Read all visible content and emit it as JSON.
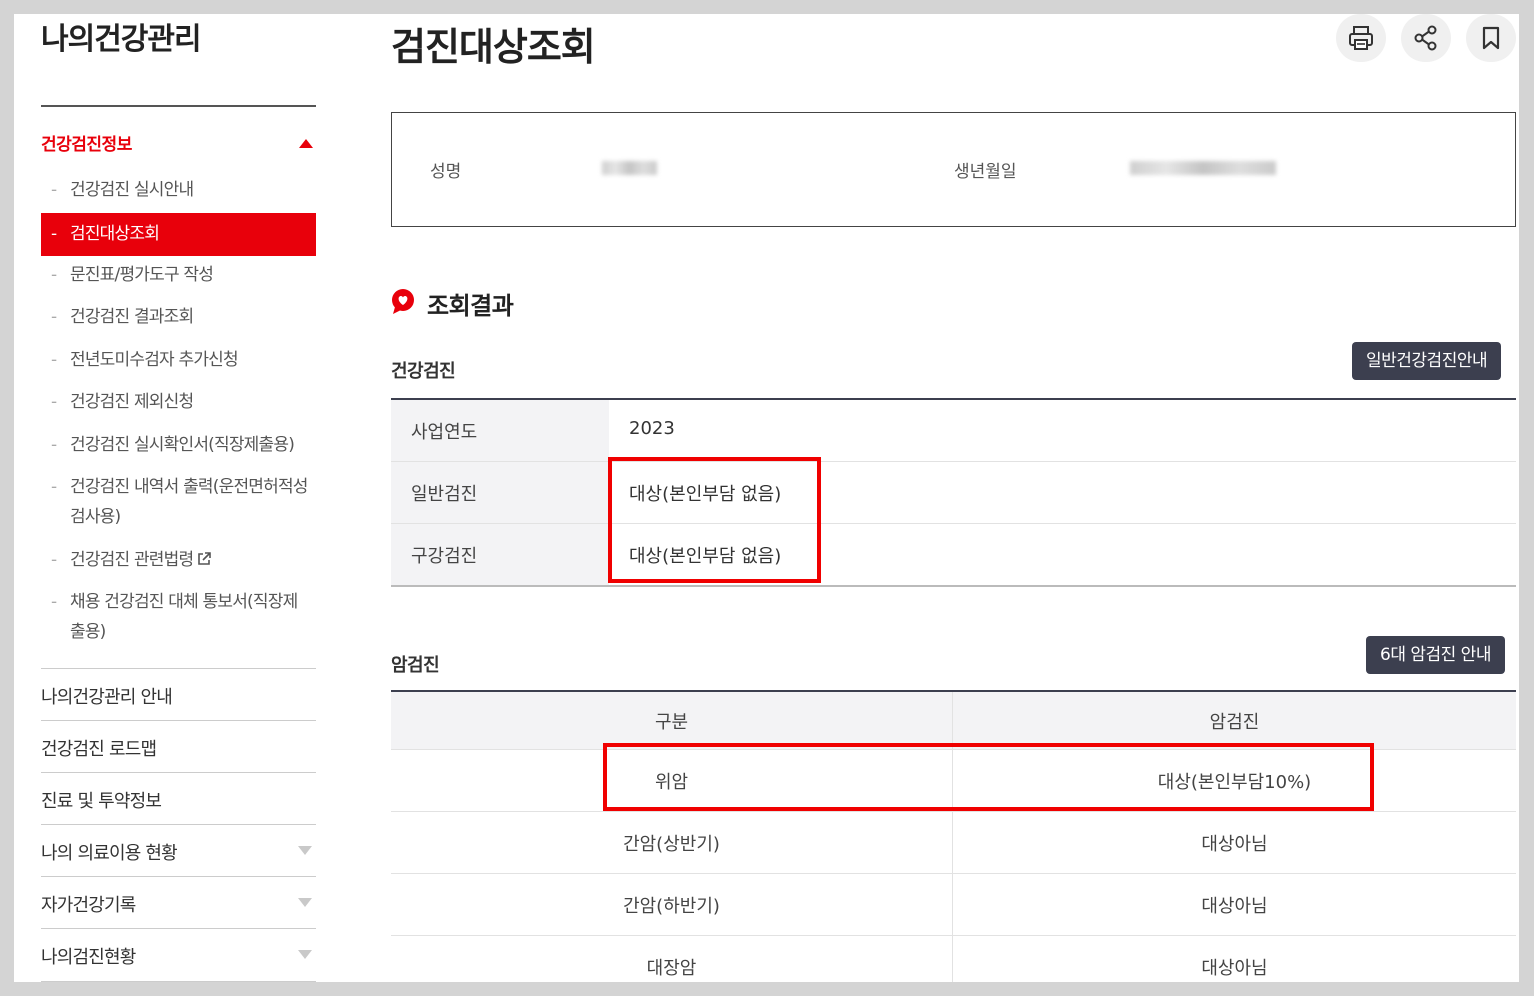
{
  "sidebar": {
    "title": "나의건강관리",
    "section": "건강검진정보",
    "sub_items": [
      {
        "label": "건강검진 실시안내"
      },
      {
        "label": "검진대상조회"
      },
      {
        "label": "문진표/평가도구 작성"
      },
      {
        "label": "건강검진 결과조회"
      },
      {
        "label": "전년도미수검자 추가신청"
      },
      {
        "label": "건강검진 제외신청"
      },
      {
        "label": "건강검진 실시확인서(직장제출용)"
      },
      {
        "label": "건강검진 내역서 출력(운전면허적성검사용)"
      },
      {
        "label": "건강검진 관련법령"
      },
      {
        "label": "채용 건강검진 대체 통보서(직장제출용)"
      }
    ],
    "menus": [
      {
        "label": "나의건강관리 안내"
      },
      {
        "label": "건강검진 로드맵"
      },
      {
        "label": "진료 및 투약정보"
      },
      {
        "label": "나의 의료이용 현황"
      },
      {
        "label": "자가건강기록"
      },
      {
        "label": "나의검진현황"
      }
    ]
  },
  "page_title": "검진대상조회",
  "toolbar": {
    "icons": [
      "print-icon",
      "share-icon",
      "bookmark-icon"
    ]
  },
  "info": {
    "name_label": "성명",
    "birth_label": "생년월일"
  },
  "result_title": "조회결과",
  "health_check": {
    "title": "건강검진",
    "guide_button": "일반건강검진안내",
    "rows": [
      {
        "label": "사업연도",
        "value": "2023"
      },
      {
        "label": "일반검진",
        "value": "대상(본인부담 없음)"
      },
      {
        "label": "구강검진",
        "value": "대상(본인부담 없음)"
      }
    ]
  },
  "cancer_check": {
    "title": "암검진",
    "guide_button": "6대 암검진 안내",
    "headers": [
      "구분",
      "암검진"
    ],
    "rows": [
      {
        "type": "위암",
        "status": "대상(본인부담10%)"
      },
      {
        "type": "간암(상반기)",
        "status": "대상아님"
      },
      {
        "type": "간암(하반기)",
        "status": "대상아님"
      },
      {
        "type": "대장암",
        "status": "대상아님"
      }
    ]
  },
  "colors": {
    "accent": "#e8000b",
    "dark_button": "#3c3f4f",
    "highlight": "#f00000"
  }
}
